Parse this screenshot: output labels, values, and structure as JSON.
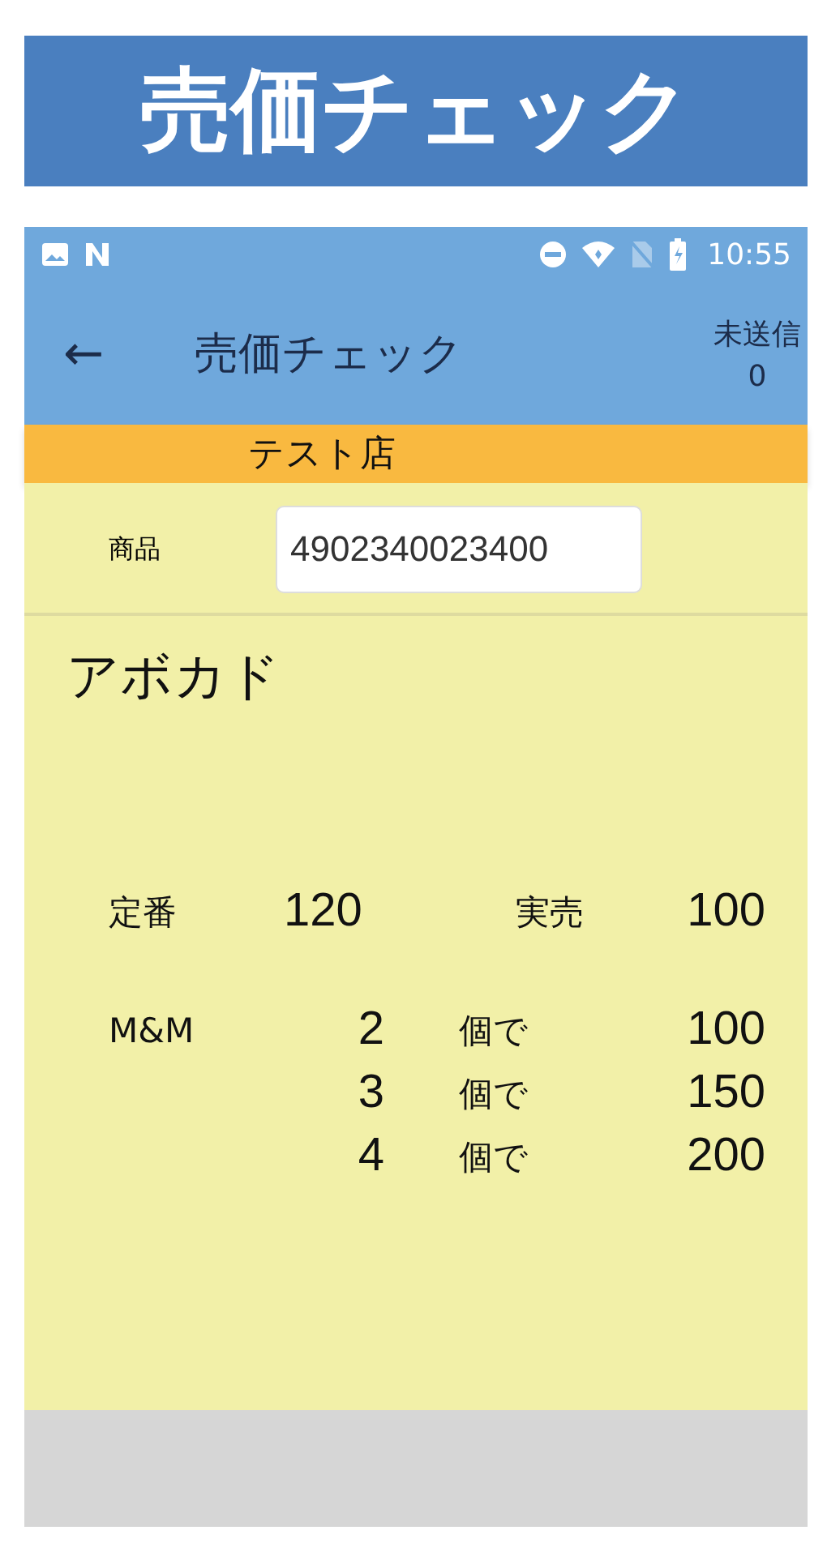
{
  "banner": {
    "title": "売価チェック"
  },
  "status_bar": {
    "time": "10:55"
  },
  "app_bar": {
    "back": "←",
    "title": "売価チェック",
    "unsent_label": "未送信",
    "unsent_count": "0"
  },
  "store": {
    "name": "テスト店"
  },
  "product": {
    "label": "商品",
    "value": "4902340023400",
    "name": "アボカド"
  },
  "prices": {
    "regular_label": "定番",
    "regular": "120",
    "actual_label": "実売",
    "actual": "100"
  },
  "mix_match": {
    "label": "M&M",
    "tiers": [
      {
        "qty": "2",
        "unit": "個で",
        "price": "100"
      },
      {
        "qty": "3",
        "unit": "個で",
        "price": "150"
      },
      {
        "qty": "4",
        "unit": "個で",
        "price": "200"
      }
    ]
  }
}
